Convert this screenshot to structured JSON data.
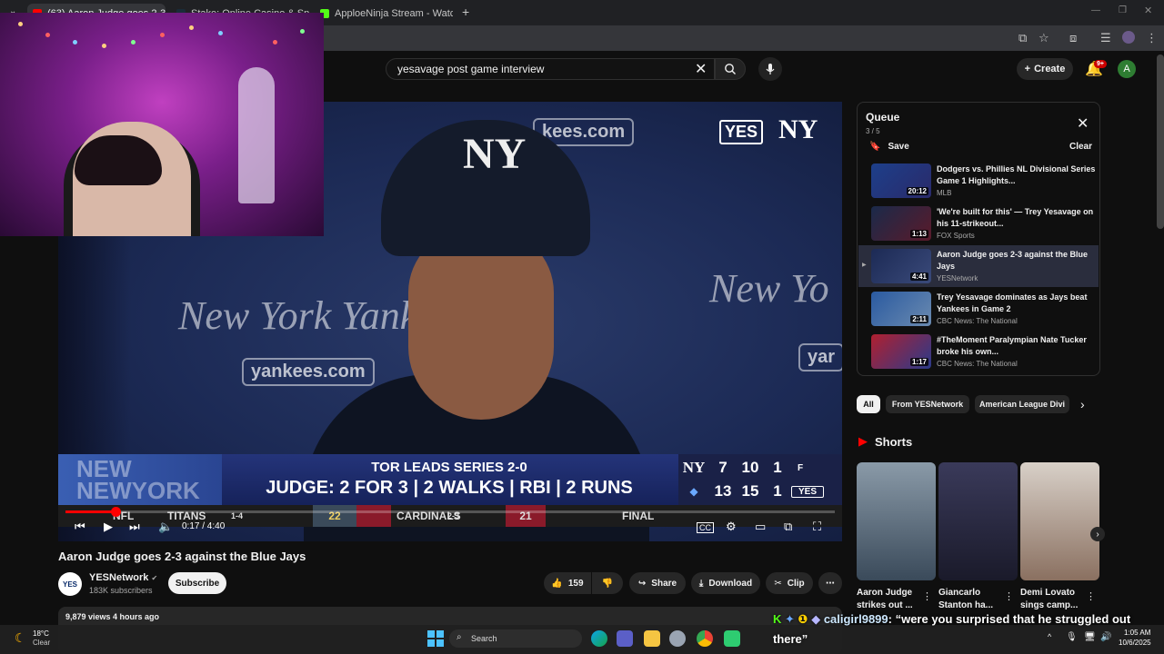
{
  "browser": {
    "tabs": [
      {
        "label": "(63) Aaron Judge goes 2-3 ag",
        "close": "✕"
      },
      {
        "label": "Stake: Online Casino & Sports",
        "close": "✕"
      },
      {
        "label": "ApploeNinja Stream - Watch Li",
        "close": "✕"
      }
    ],
    "new_tab": "+"
  },
  "youtube": {
    "search_value": "yesavage post game interview",
    "create_label": "Create",
    "notification_count": "9+",
    "avatar_letter": "A"
  },
  "video": {
    "bg_text_left": "New York Yank",
    "bg_text_right": "New Yo",
    "bg_site_left": "yankees.com",
    "bg_site_top": "kees.com",
    "bg_site_right": "yar",
    "yes_logo": "YES",
    "ny_logo": "NY",
    "cap_logo": "NY",
    "bug_left": "NEW\nNEWYORK",
    "headline": "TOR LEADS SERIES 2-0",
    "stats": "JUDGE: 2 FOR 3 | 2 WALKS | RBI | 2 RUNS",
    "score": {
      "nyy": {
        "r": "7",
        "h": "10",
        "e": "1"
      },
      "tor": {
        "r": "13",
        "h": "15",
        "e": "1"
      },
      "final": "F",
      "network": "YES"
    },
    "ticker": {
      "league": "NFL",
      "team1": "TITANS",
      "rec1": "1-4",
      "score1": "22",
      "team2": "CARDINALS",
      "rec2": "2-3",
      "score2": "21",
      "status": "FINAL"
    },
    "time": "0:17 / 4:40",
    "progress": 0.065
  },
  "watch": {
    "title": "Aaron Judge goes 2-3 against the Blue Jays",
    "channel_logo": "YES",
    "channel": "YESNetwork",
    "verified": "✔",
    "subs": "183K subscribers",
    "subscribe": "Subscribe",
    "likes": "159",
    "share": "Share",
    "download": "Download",
    "clip": "Clip",
    "more": "⋯",
    "views": "9,879 views  4 hours ago"
  },
  "queue": {
    "title": "Queue",
    "count": "3 / 5",
    "save": "Save",
    "clear": "Clear",
    "items": [
      {
        "title": "Dodgers vs. Phillies NL Divisional Series Game 1 Highlights...",
        "channel": "MLB",
        "duration": "20:12"
      },
      {
        "title": "'We're built for this' — Trey Yesavage on his 11-strikeout...",
        "channel": "FOX Sports",
        "duration": "1:13"
      },
      {
        "title": "Aaron Judge goes 2-3 against the Blue Jays",
        "channel": "YESNetwork",
        "duration": "4:41"
      },
      {
        "title": "Trey Yesavage dominates as Jays beat Yankees in Game 2",
        "channel": "CBC News: The National",
        "duration": "2:11"
      },
      {
        "title": "#TheMoment Paralympian Nate Tucker broke his own...",
        "channel": "CBC News: The National",
        "duration": "1:17"
      }
    ]
  },
  "chips": [
    "All",
    "From YESNetwork",
    "American League Divi"
  ],
  "shorts": {
    "heading": "Shorts",
    "items": [
      {
        "title": "Aaron Judge strikes out ..."
      },
      {
        "title": "Giancarlo Stanton ha..."
      },
      {
        "title": "Demi Lovato sings camp..."
      }
    ]
  },
  "chat": {
    "user": "caligirl9899",
    "message": ": “were you surprised that he struggled out there”"
  },
  "taskbar": {
    "temp": "18°C",
    "weather": "Clear",
    "search": "Search",
    "time": "1:05 AM",
    "date": "10/6/2025"
  },
  "colors": {
    "accent": "#ff0000",
    "background": "#0f0f0f",
    "surface": "#272727"
  }
}
